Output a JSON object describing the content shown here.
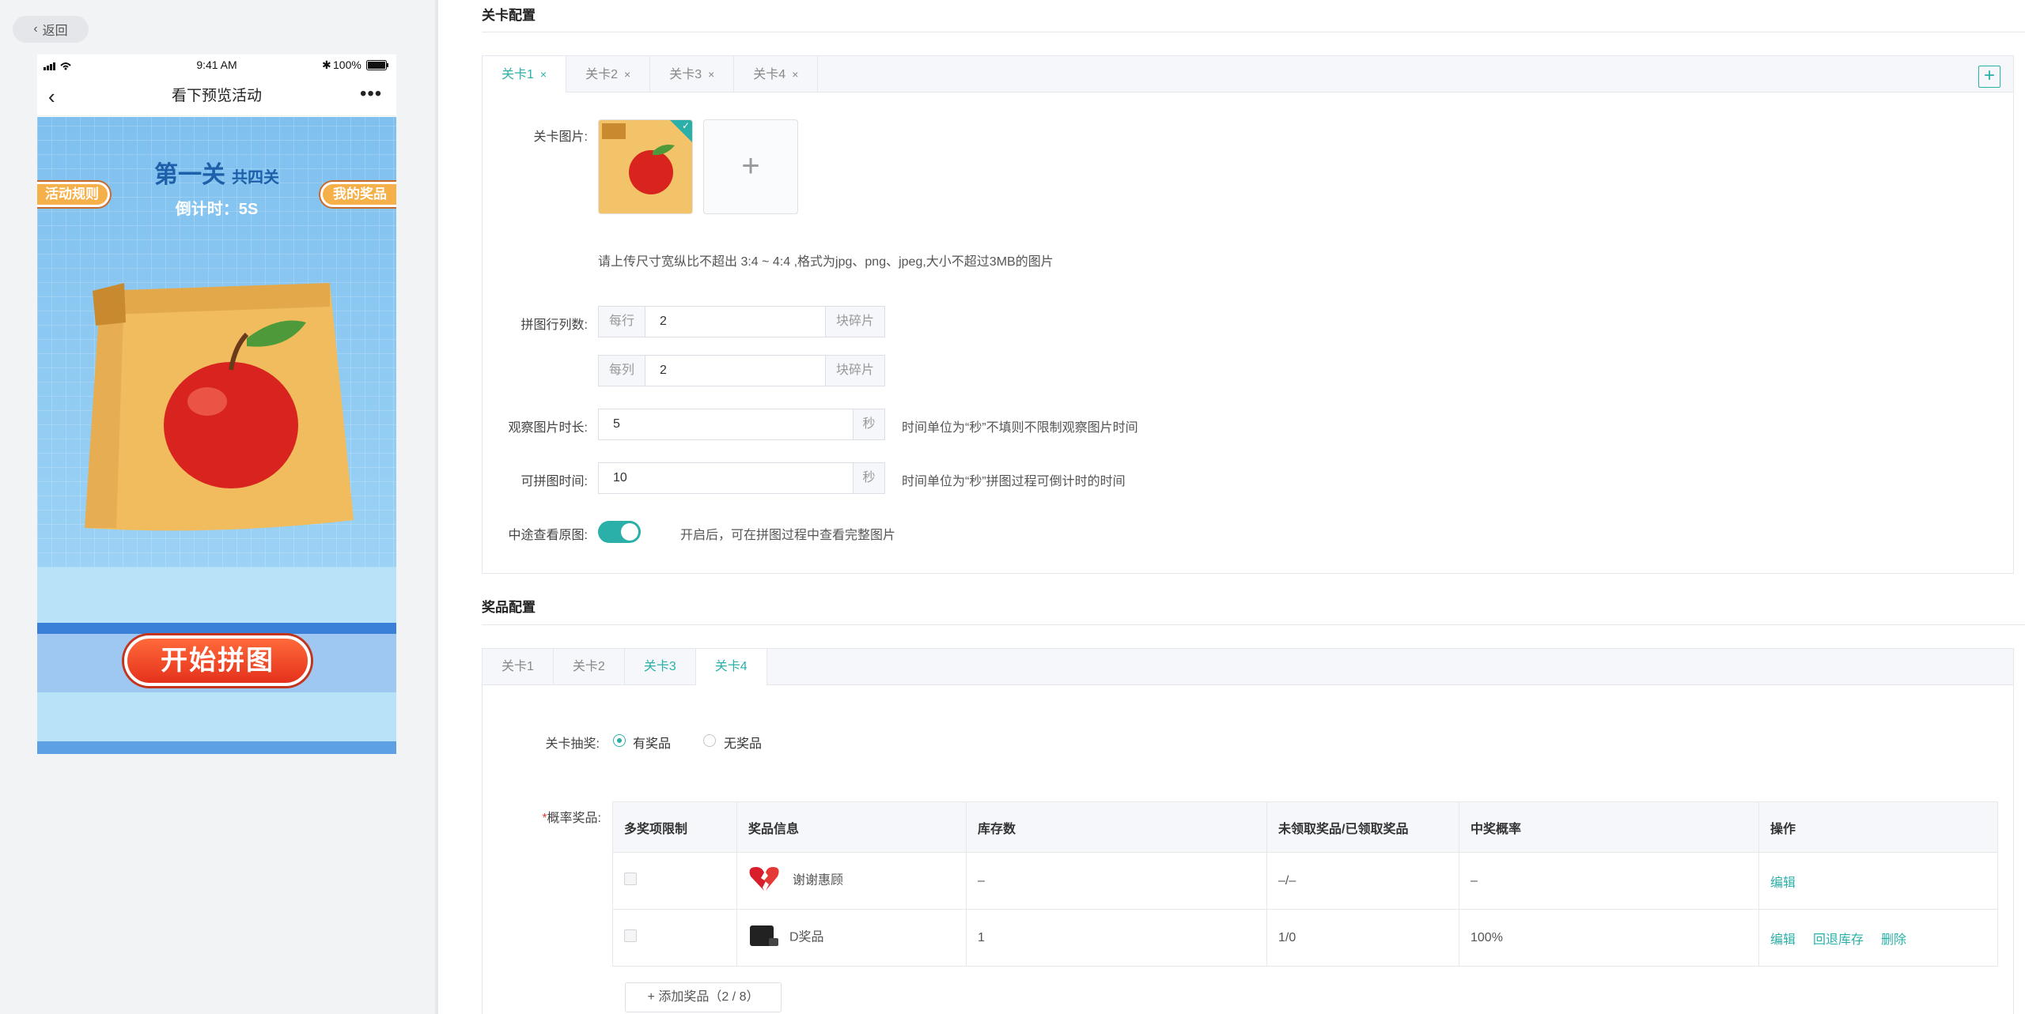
{
  "back": {
    "label": "返回"
  },
  "phone": {
    "time": "9:41 AM",
    "battery": "100%",
    "nav_title": "看下预览活动",
    "level_title": "第一关",
    "level_total": "共四关",
    "countdown": "倒计时：5S",
    "rules_btn": "活动规则",
    "prize_btn": "我的奖品",
    "start_btn": "开始拼图"
  },
  "level_section": {
    "title": "关卡配置",
    "tabs": [
      {
        "label": "关卡1",
        "active": true
      },
      {
        "label": "关卡2",
        "active": false
      },
      {
        "label": "关卡3",
        "active": false
      },
      {
        "label": "关卡4",
        "active": false
      }
    ],
    "image_label": "关卡图片:",
    "image_hint": "请上传尺寸宽纵比不超出 3:4 ~ 4:4 ,格式为jpg、png、jpeg,大小不超过3MB的图片",
    "grid_label": "拼图行列数:",
    "row_prefix": "每行",
    "row_value": "2",
    "col_prefix": "每列",
    "col_value": "2",
    "piece_suffix": "块碎片",
    "observe_label": "观察图片时长:",
    "observe_value": "5",
    "observe_unit": "秒",
    "observe_hint": "时间单位为“秒”不填则不限制观察图片时间",
    "puzzle_label": "可拼图时间:",
    "puzzle_value": "10",
    "puzzle_unit": "秒",
    "puzzle_hint": "时间单位为“秒”拼图过程可倒计时的时间",
    "peek_label": "中途查看原图:",
    "peek_on": true,
    "peek_hint": "开启后，可在拼图过程中查看完整图片"
  },
  "prize_section": {
    "title": "奖品配置",
    "tabs": [
      {
        "label": "关卡1",
        "state": "normal"
      },
      {
        "label": "关卡2",
        "state": "normal"
      },
      {
        "label": "关卡3",
        "state": "teal"
      },
      {
        "label": "关卡4",
        "state": "active"
      }
    ],
    "draw_label": "关卡抽奖:",
    "opt_yes": "有奖品",
    "opt_no": "无奖品",
    "prob_label": "概率奖品:",
    "columns": [
      "多奖项限制",
      "奖品信息",
      "库存数",
      "未领取奖品/已领取奖品",
      "中奖概率",
      "操作"
    ],
    "rows": [
      {
        "name": "谢谢惠顾",
        "stock": "–",
        "claimed": "–/–",
        "prob": "–",
        "actions": [
          "编辑"
        ]
      },
      {
        "name": "D奖品",
        "stock": "1",
        "claimed": "1/0",
        "prob": "100%",
        "actions": [
          "编辑",
          "回退库存",
          "删除"
        ]
      }
    ],
    "add_btn": "添加奖品（2 / 8）"
  },
  "colors": {
    "accent": "#2ab0a8",
    "start_button": "#e4321c"
  }
}
